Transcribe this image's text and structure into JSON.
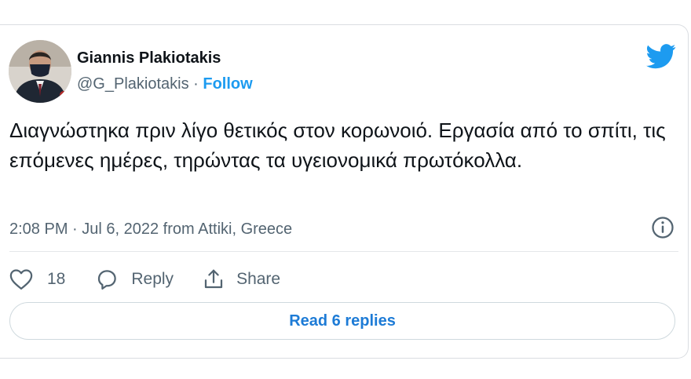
{
  "author": {
    "name": "Giannis Plakiotakis",
    "handle": "@G_Plakiotakis",
    "separator": "·",
    "follow_label": "Follow"
  },
  "tweet": {
    "text": "Διαγνώστηκα πριν λίγο θετικός στον κορωνοιό. Εργασία από το σπίτι, τις επόμενες ημέρες, τηρώντας τα υγειονομικά πρωτόκολλα.",
    "timestamp": "2:08 PM · Jul 6, 2022 from Attiki, Greece"
  },
  "actions": {
    "like_count": "18",
    "reply_label": "Reply",
    "share_label": "Share"
  },
  "read_replies_label": "Read 6 replies",
  "icons": {
    "brand": "twitter-bird-icon",
    "info": "info-icon",
    "like": "heart-icon",
    "reply": "speech-bubble-icon",
    "share": "share-upload-icon"
  },
  "colors": {
    "accent": "#1d9bf0",
    "text": "#0f1419",
    "muted": "#536471",
    "border": "#cfd9de"
  }
}
